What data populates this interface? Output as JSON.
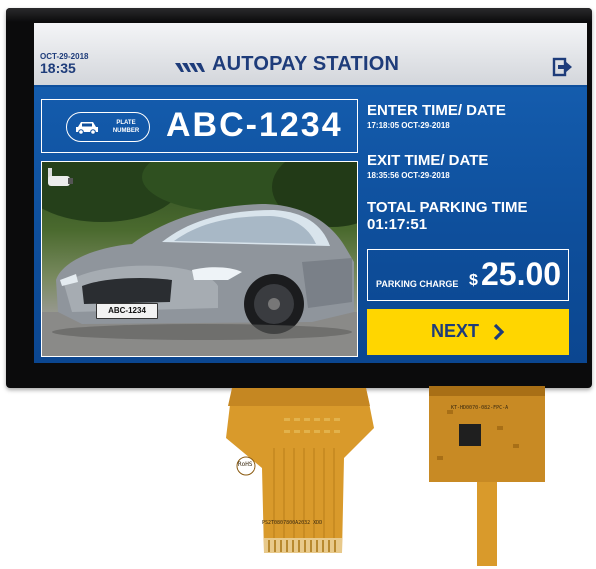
{
  "header": {
    "date": "OCT-29-2018",
    "time": "18:35",
    "title": "AUTOPAY STATION",
    "exit_icon": "logout-icon"
  },
  "plate": {
    "pill_label_line1": "PLATE",
    "pill_label_line2": "NUMBER",
    "number": "ABC-1234",
    "photo_plate_text": "ABC-1234"
  },
  "info": {
    "enter_label": "ENTER TIME/ DATE",
    "enter_value": "17:18:05 OCT-29-2018",
    "exit_label": "EXIT TIME/ DATE",
    "exit_value": "18:35:56 OCT-29-2018",
    "total_label": "TOTAL PARKING TIME",
    "total_value": "01:17:51"
  },
  "charge": {
    "label": "PARKING CHARGE",
    "currency": "$",
    "amount": "25.00"
  },
  "next_button": {
    "label": "NEXT"
  },
  "hardware": {
    "fpc_left_code": "PS2T0807800A2032 XDD",
    "fpc_left_rohs": "RoHS",
    "fpc_right_code": "KT-HD0070-082-FPC-A"
  },
  "colors": {
    "screen_blue": "#0e4f9c",
    "title_navy": "#1e3c7a",
    "button_yellow": "#ffd600",
    "flex_cable": "#d99a2b"
  }
}
